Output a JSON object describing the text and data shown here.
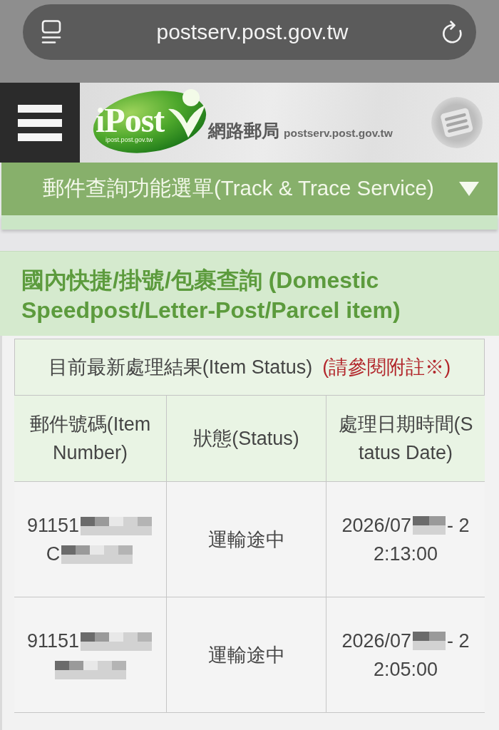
{
  "browser": {
    "url": "postserv.post.gov.tw"
  },
  "header": {
    "logo_text": "iPost",
    "logo_caption": "ipost.post.gov.tw",
    "site_name": "網路郵局",
    "site_url": "postserv.post.gov.tw"
  },
  "menu": {
    "label": "郵件查詢功能選單(Track & Trace Service)",
    "expanded": false
  },
  "section": {
    "title": "國內快捷/掛號/包裹查詢 (Domestic Speedpost/Letter-Post/Parcel item)"
  },
  "table": {
    "caption": "目前最新處理結果(Item Status)",
    "caption_note": "(請參閱附註※)",
    "columns": [
      "郵件號碼(Item Number)",
      "狀態(Status)",
      "處理日期時間(Status Date)"
    ],
    "rows": [
      {
        "item_number": [
          {
            "kind": "text",
            "text": "91151"
          },
          {
            "kind": "redacted"
          },
          {
            "kind": "text",
            "text": "C"
          },
          {
            "kind": "redacted"
          }
        ],
        "status": "運輸途中",
        "date_lines": [
          [
            {
              "kind": "text",
              "text": "2026/07"
            },
            {
              "kind": "redacted"
            },
            {
              "kind": "text",
              "text": "- 2"
            }
          ],
          [
            {
              "kind": "text",
              "text": "2:13:00"
            }
          ]
        ]
      },
      {
        "item_number": [
          {
            "kind": "text",
            "text": "91151"
          },
          {
            "kind": "redacted"
          },
          {
            "kind": "redacted"
          }
        ],
        "status": "運輸途中",
        "date_lines": [
          [
            {
              "kind": "text",
              "text": "2026/07"
            },
            {
              "kind": "redacted"
            },
            {
              "kind": "text",
              "text": "- 2"
            }
          ],
          [
            {
              "kind": "text",
              "text": "2:05:00"
            }
          ]
        ]
      }
    ]
  }
}
